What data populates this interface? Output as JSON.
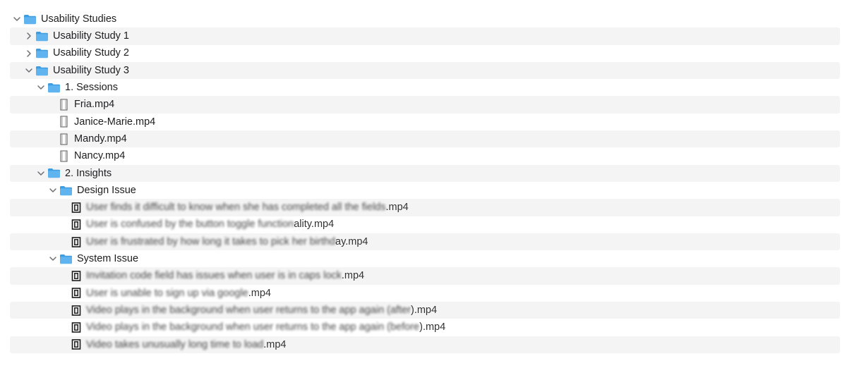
{
  "tree": [
    {
      "depth": 0,
      "type": "folder",
      "expanded": true,
      "label": "Usability Studies",
      "icon": "folder-icon"
    },
    {
      "depth": 1,
      "type": "folder",
      "expanded": false,
      "label": "Usability Study 1",
      "icon": "folder-icon"
    },
    {
      "depth": 1,
      "type": "folder",
      "expanded": false,
      "label": "Usability Study 2",
      "icon": "folder-icon"
    },
    {
      "depth": 1,
      "type": "folder",
      "expanded": true,
      "label": "Usability Study 3",
      "icon": "folder-icon"
    },
    {
      "depth": 2,
      "type": "folder",
      "expanded": true,
      "label": "1. Sessions",
      "icon": "folder-icon"
    },
    {
      "depth": 3,
      "type": "file",
      "label": "Fria.mp4",
      "icon": "video-file-icon"
    },
    {
      "depth": 3,
      "type": "file",
      "label": "Janice-Marie.mp4",
      "icon": "video-file-icon"
    },
    {
      "depth": 3,
      "type": "file",
      "label": "Mandy.mp4",
      "icon": "video-file-icon"
    },
    {
      "depth": 3,
      "type": "file",
      "label": "Nancy.mp4",
      "icon": "video-file-icon"
    },
    {
      "depth": 2,
      "type": "folder",
      "expanded": true,
      "label": "2. Insights",
      "icon": "folder-icon"
    },
    {
      "depth": 3,
      "type": "folder",
      "expanded": true,
      "label": "Design Issue",
      "icon": "folder-icon"
    },
    {
      "depth": 4,
      "type": "file",
      "label": "User finds it difficult to know when she has completed all the fields.mp4",
      "blurred_prefix": "User finds it difficult to know when she has completed all the fields",
      "clear_suffix": ".mp4",
      "icon": "video-thumbnail-icon"
    },
    {
      "depth": 4,
      "type": "file",
      "label": "User is confused by the button toggle functionality.mp4",
      "blurred_prefix": "User is confused by the button toggle function",
      "clear_suffix": "ality.mp4",
      "icon": "video-thumbnail-icon"
    },
    {
      "depth": 4,
      "type": "file",
      "label": "User is frustrated by how long it takes to pick her birthday.mp4",
      "blurred_prefix": "User is frustrated by how long it takes to pick her birthd",
      "clear_suffix": "ay.mp4",
      "icon": "video-thumbnail-icon"
    },
    {
      "depth": 3,
      "type": "folder",
      "expanded": true,
      "label": "System Issue",
      "icon": "folder-icon"
    },
    {
      "depth": 4,
      "type": "file",
      "label": "Invitation code field has issues when user is in caps lock.mp4",
      "blurred_prefix": "Invitation code field has issues when user is in caps lock",
      "clear_suffix": ".mp4",
      "icon": "video-thumbnail-icon"
    },
    {
      "depth": 4,
      "type": "file",
      "label": "User is unable to sign up via google.mp4",
      "blurred_prefix": "User is unable to sign up via google",
      "clear_suffix": ".mp4",
      "icon": "video-thumbnail-icon"
    },
    {
      "depth": 4,
      "type": "file",
      "label": "Video plays in the background when user returns to the app again (after).mp4",
      "blurred_prefix": "Video plays in the background when user returns to the app again (after",
      "clear_suffix": ").mp4",
      "icon": "video-thumbnail-icon"
    },
    {
      "depth": 4,
      "type": "file",
      "label": "Video plays in the background when user returns to the app again (before).mp4",
      "blurred_prefix": "Video plays in the background when user returns to the app again (before",
      "clear_suffix": ").mp4",
      "icon": "video-thumbnail-icon"
    },
    {
      "depth": 4,
      "type": "file",
      "label": "Video takes unusually long time to load.mp4",
      "blurred_prefix": "Video takes unusually long time to load",
      "clear_suffix": ".mp4",
      "icon": "video-thumbnail-icon"
    }
  ],
  "colors": {
    "folder": "#5fb4ef",
    "folder_tab": "#3d9de0",
    "stripe": "#f4f4f5",
    "text": "#1d1d1f",
    "chevron": "#6e6e73"
  }
}
